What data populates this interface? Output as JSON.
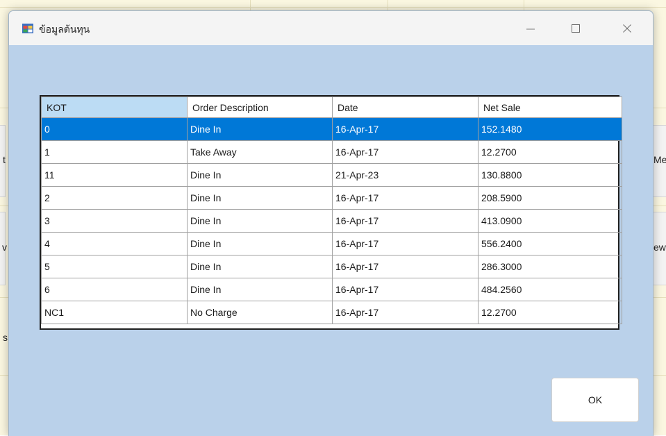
{
  "window": {
    "title": "ข้อมูลต้นทุน",
    "icon": "form-icon"
  },
  "background": {
    "partial_labels": [
      "t",
      "Me",
      "v",
      "ew",
      "s"
    ]
  },
  "grid": {
    "columns": [
      "KOT",
      "Order Description",
      "Date",
      "Net Sale"
    ],
    "selected_row": 0,
    "rows": [
      [
        "0",
        "Dine In",
        "16-Apr-17",
        "152.1480"
      ],
      [
        "1",
        "Take Away",
        "16-Apr-17",
        "12.2700"
      ],
      [
        "11",
        "Dine In",
        "21-Apr-23",
        "130.8800"
      ],
      [
        "2",
        "Dine In",
        "16-Apr-17",
        "208.5900"
      ],
      [
        "3",
        "Dine In",
        "16-Apr-17",
        "413.0900"
      ],
      [
        "4",
        "Dine In",
        "16-Apr-17",
        "556.2400"
      ],
      [
        "5",
        "Dine In",
        "16-Apr-17",
        "286.3000"
      ],
      [
        "6",
        "Dine In",
        "16-Apr-17",
        "484.2560"
      ],
      [
        "NC1",
        "No Charge",
        "16-Apr-17",
        "12.2700"
      ]
    ]
  },
  "buttons": {
    "ok_label": "OK"
  },
  "colors": {
    "window_bg": "#bad1ea",
    "selection": "#0078d7",
    "header_active": "#bcdcf4"
  }
}
